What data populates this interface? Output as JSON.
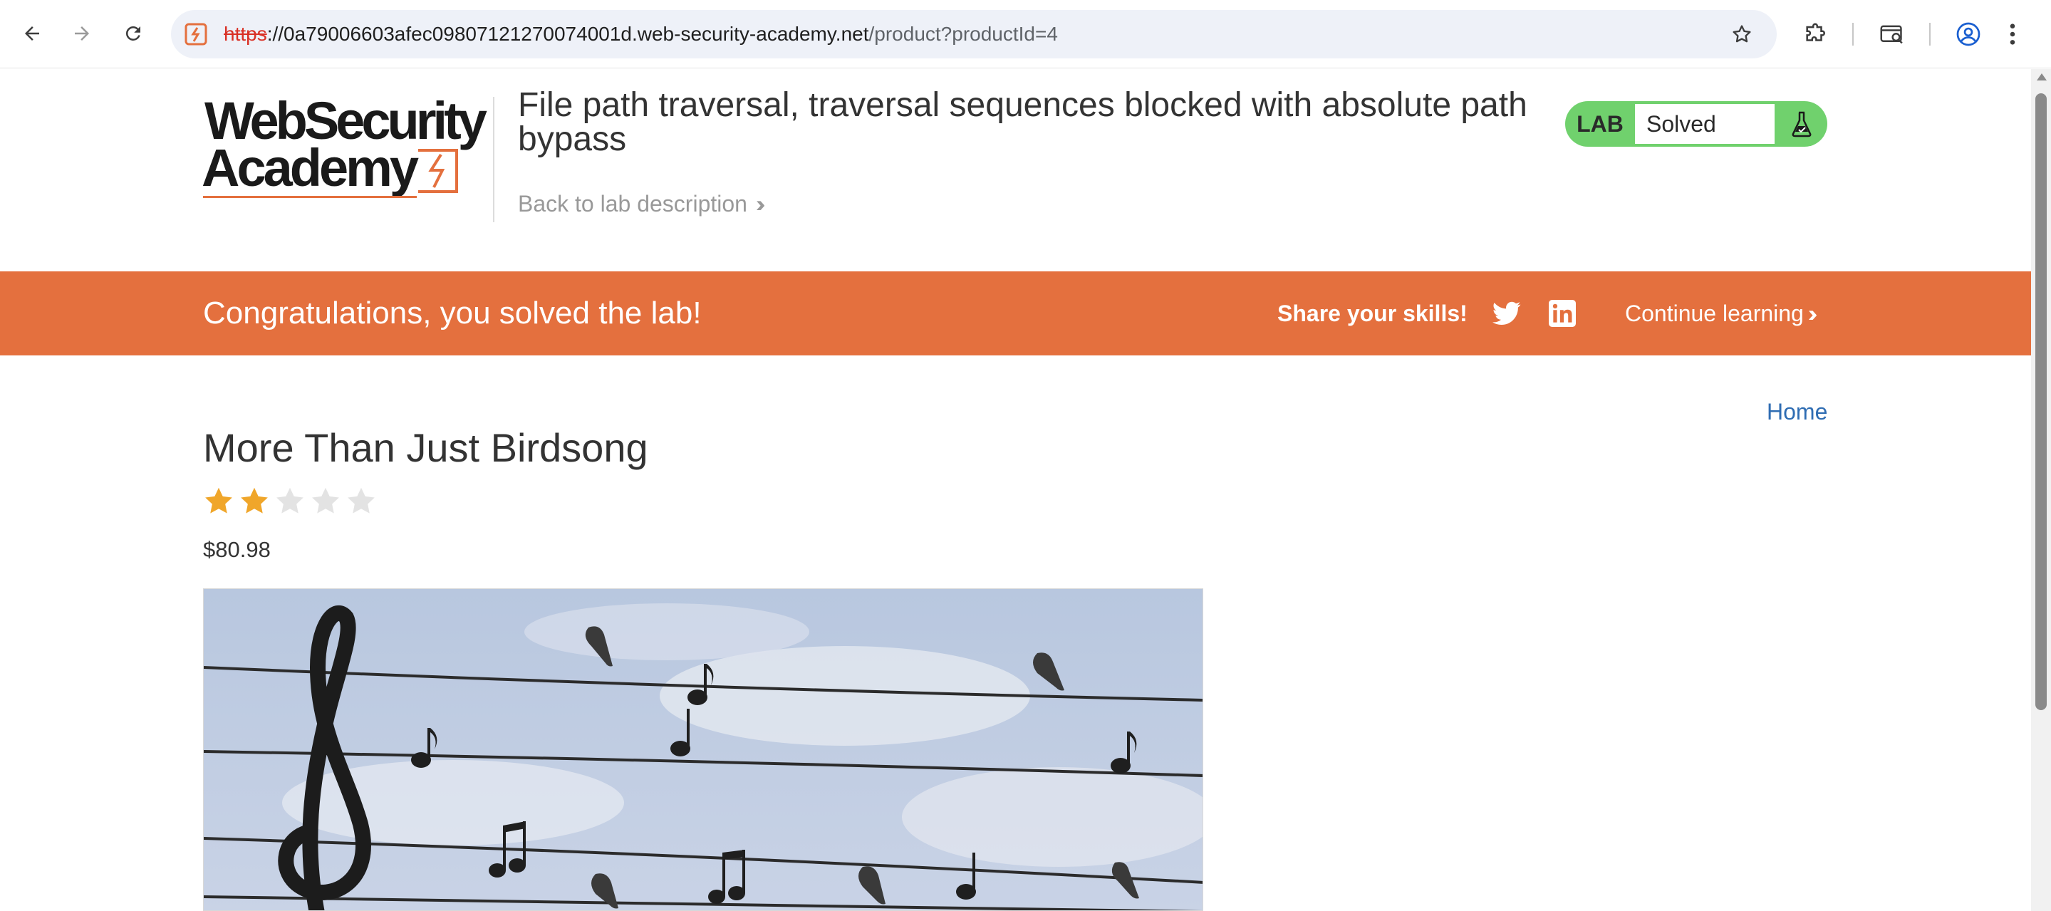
{
  "browser": {
    "url_scheme": "https",
    "url_host": "://0a79006603afec09807121270074001d.web-security-academy.net",
    "url_path": "/product?productId=4"
  },
  "logo": {
    "line1": "WebSecurity",
    "line2": "Academy",
    "accent_color": "#e4703e"
  },
  "header": {
    "lab_title": "File path traversal, traversal sequences blocked with absolute path bypass",
    "back_link": "Back to lab description"
  },
  "lab_badge": {
    "label": "LAB",
    "status": "Solved",
    "color": "#70d16d"
  },
  "banner": {
    "message": "Congratulations, you solved the lab!",
    "share": "Share your skills!",
    "continue": "Continue learning",
    "color": "#e4703e"
  },
  "nav": {
    "home": "Home"
  },
  "product": {
    "title": "More Than Just Birdsong",
    "rating": 2,
    "rating_max": 5,
    "price": "$80.98"
  }
}
